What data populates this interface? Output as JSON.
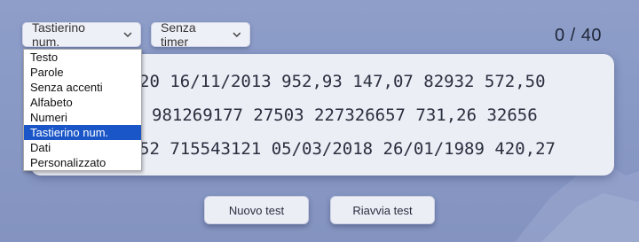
{
  "controls": {
    "mode_selected": "Tastierino num.",
    "timer_selected": "Senza timer"
  },
  "counter": "0 / 40",
  "mode_options": [
    "Testo",
    "Parole",
    "Senza accenti",
    "Alfabeto",
    "Numeri",
    "Tastierino num.",
    "Dati",
    "Personalizzato"
  ],
  "selected_option_index": 5,
  "text_lines": [
    "20 16/11/2013 952,93 147,07 82932 572,50",
    "981269177 27503 227326657 731,26 32656",
    "52 715543121 05/03/2018 26/01/1989 420,27"
  ],
  "buttons": {
    "new_test": "Nuovo test",
    "restart_test": "Riavvia test"
  },
  "icons": {
    "select_chevron": "chevron-down-icon"
  },
  "colors": {
    "background": "#8898c5",
    "panel": "#eceef6",
    "selected_option": "#1a56c8"
  }
}
